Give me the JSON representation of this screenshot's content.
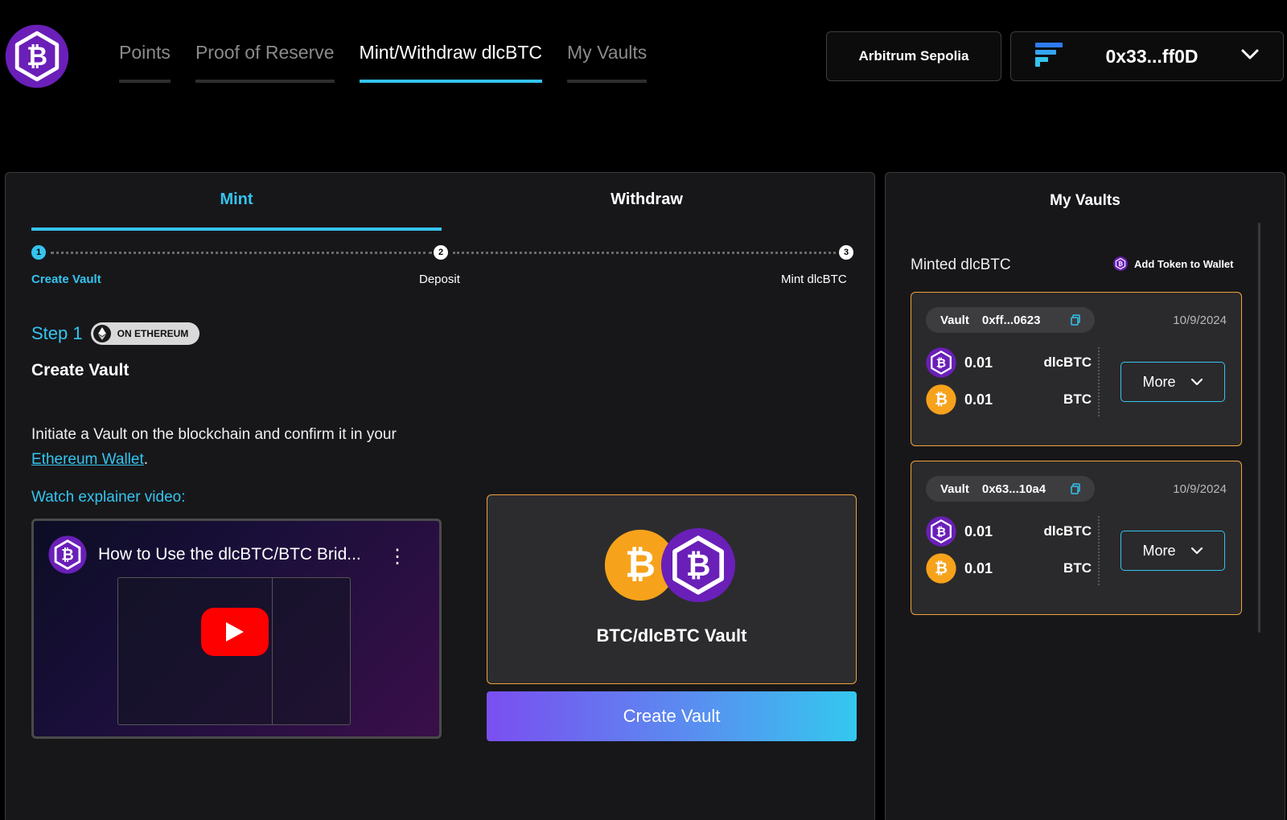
{
  "header": {
    "logo_icon": "dlcbtc-logo-icon",
    "nav": [
      {
        "label": "Points",
        "active": false
      },
      {
        "label": "Proof of Reserve",
        "active": false
      },
      {
        "label": "Mint/Withdraw dlcBTC",
        "active": true
      },
      {
        "label": "My Vaults",
        "active": false
      }
    ],
    "network_label": "Arbitrum Sepolia",
    "wallet_address": "0x33...ff0D",
    "wallet_icon": "wallet-provider-icon",
    "chevron_icon": "chevron-down-icon"
  },
  "main": {
    "tabs": [
      {
        "label": "Mint",
        "active": true
      },
      {
        "label": "Withdraw",
        "active": false
      }
    ],
    "stepper": [
      {
        "num": "1",
        "label": "Create Vault",
        "active": true
      },
      {
        "num": "2",
        "label": "Deposit",
        "active": false
      },
      {
        "num": "3",
        "label": "Mint dlcBTC",
        "active": false
      }
    ],
    "step_label": "Step 1",
    "chain_badge": "ON ETHEREUM",
    "title": "Create Vault",
    "description_prefix": "Initiate a Vault on the blockchain and confirm it in your ",
    "description_link": "Ethereum Wallet",
    "description_suffix": ".",
    "watch_label": "Watch explainer video:",
    "video_title": "How to Use the dlcBTC/BTC Brid...",
    "vault_card_label": "BTC/dlcBTC Vault",
    "create_button": "Create Vault"
  },
  "side": {
    "title": "My Vaults",
    "minted_label": "Minted dlcBTC",
    "add_token_label": "Add Token to Wallet",
    "vaults": [
      {
        "vault_label": "Vault",
        "vault_id": "0xff...0623",
        "date": "10/9/2024",
        "rows": [
          {
            "amount": "0.01",
            "symbol": "dlcBTC"
          },
          {
            "amount": "0.01",
            "symbol": "BTC"
          }
        ],
        "more_label": "More"
      },
      {
        "vault_label": "Vault",
        "vault_id": "0x63...10a4",
        "date": "10/9/2024",
        "rows": [
          {
            "amount": "0.01",
            "symbol": "dlcBTC"
          },
          {
            "amount": "0.01",
            "symbol": "BTC"
          }
        ],
        "more_label": "More"
      }
    ]
  },
  "colors": {
    "accent": "#35c4ef",
    "dlcbtc_purple": "#6a1fb8",
    "btc_orange": "#f7a21b",
    "card_border": "#f0a33a"
  }
}
